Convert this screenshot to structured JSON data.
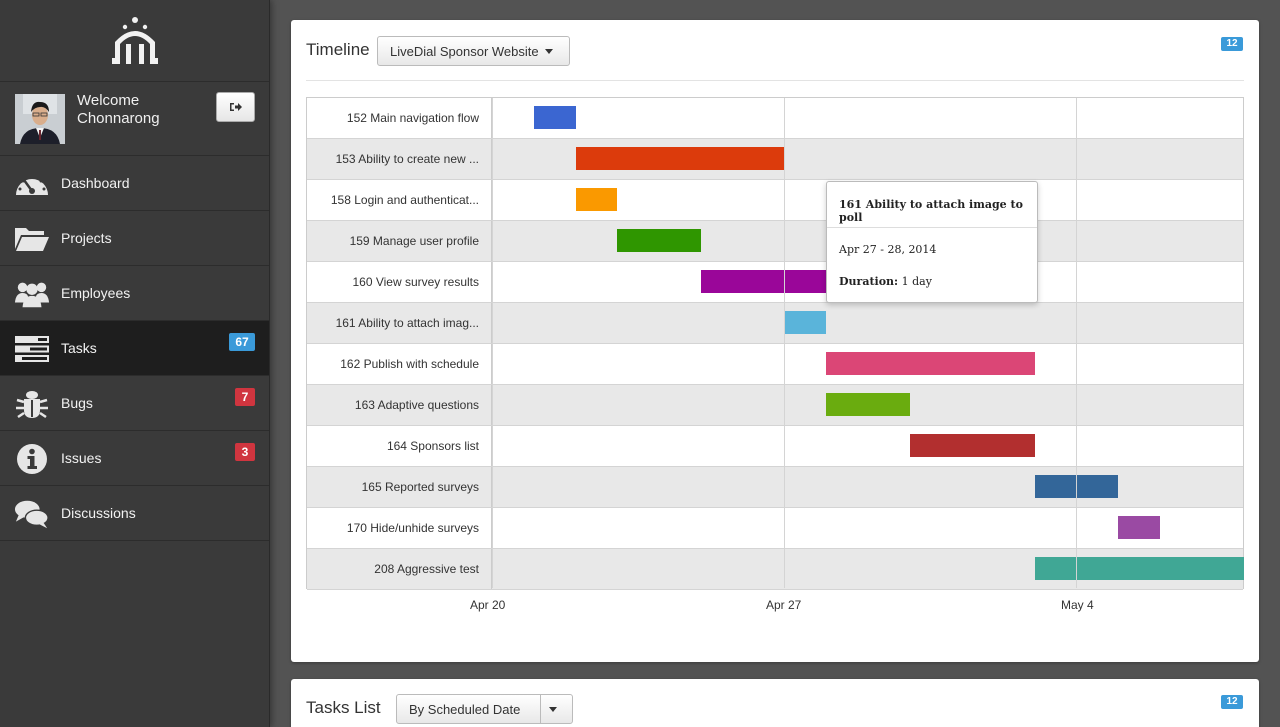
{
  "sidebar": {
    "welcome": "Welcome",
    "user_name": "Chonnarong",
    "items": [
      {
        "label": "Dashboard",
        "icon": "dashboard-icon",
        "badge": ""
      },
      {
        "label": "Projects",
        "icon": "folder-icon",
        "badge": ""
      },
      {
        "label": "Employees",
        "icon": "people-icon",
        "badge": ""
      },
      {
        "label": "Tasks",
        "icon": "tasks-icon",
        "badge": "67"
      },
      {
        "label": "Bugs",
        "icon": "bug-icon",
        "badge": "7"
      },
      {
        "label": "Issues",
        "icon": "info-icon",
        "badge": "3"
      },
      {
        "label": "Discussions",
        "icon": "chat-icon",
        "badge": ""
      }
    ]
  },
  "timeline": {
    "title": "Timeline",
    "project": "LiveDial Sponsor Website",
    "count": "12",
    "axis_labels": [
      "Apr 20",
      "Apr 27",
      "May 4"
    ],
    "tasks": [
      {
        "label": "152 Main navigation flow",
        "start": 1,
        "end": 2,
        "color": "#3b66d1"
      },
      {
        "label": "153 Ability to create new ...",
        "start": 2,
        "end": 7,
        "color": "#dc3b0c"
      },
      {
        "label": "158 Login and authenticat...",
        "start": 2,
        "end": 3,
        "color": "#fa9900"
      },
      {
        "label": "159 Manage user profile",
        "start": 3,
        "end": 5,
        "color": "#2f9600"
      },
      {
        "label": "160 View survey results",
        "start": 5,
        "end": 8,
        "color": "#9a0699"
      },
      {
        "label": "161 Ability to attach imag...",
        "start": 7,
        "end": 8,
        "color": "#5ab4da"
      },
      {
        "label": "162 Publish with schedule",
        "start": 8,
        "end": 13,
        "color": "#db4676"
      },
      {
        "label": "163 Adaptive questions",
        "start": 8,
        "end": 10,
        "color": "#6aac0f"
      },
      {
        "label": "164 Sponsors list",
        "start": 10,
        "end": 13,
        "color": "#b22f2f"
      },
      {
        "label": "165 Reported surveys",
        "start": 13,
        "end": 15,
        "color": "#336699"
      },
      {
        "label": "170 Hide/unhide surveys",
        "start": 15,
        "end": 16,
        "color": "#9a4aa3"
      },
      {
        "label": "208 Aggressive test",
        "start": 13,
        "end": 18,
        "color": "#40a795"
      }
    ],
    "tooltip": {
      "title": "161 Ability to attach image to poll",
      "dates": "Apr 27 - 28, 2014",
      "duration_label": "Duration:",
      "duration_value": "1 day"
    }
  },
  "tasks_list": {
    "title": "Tasks List",
    "sort": "By Scheduled Date",
    "count": "12"
  }
}
